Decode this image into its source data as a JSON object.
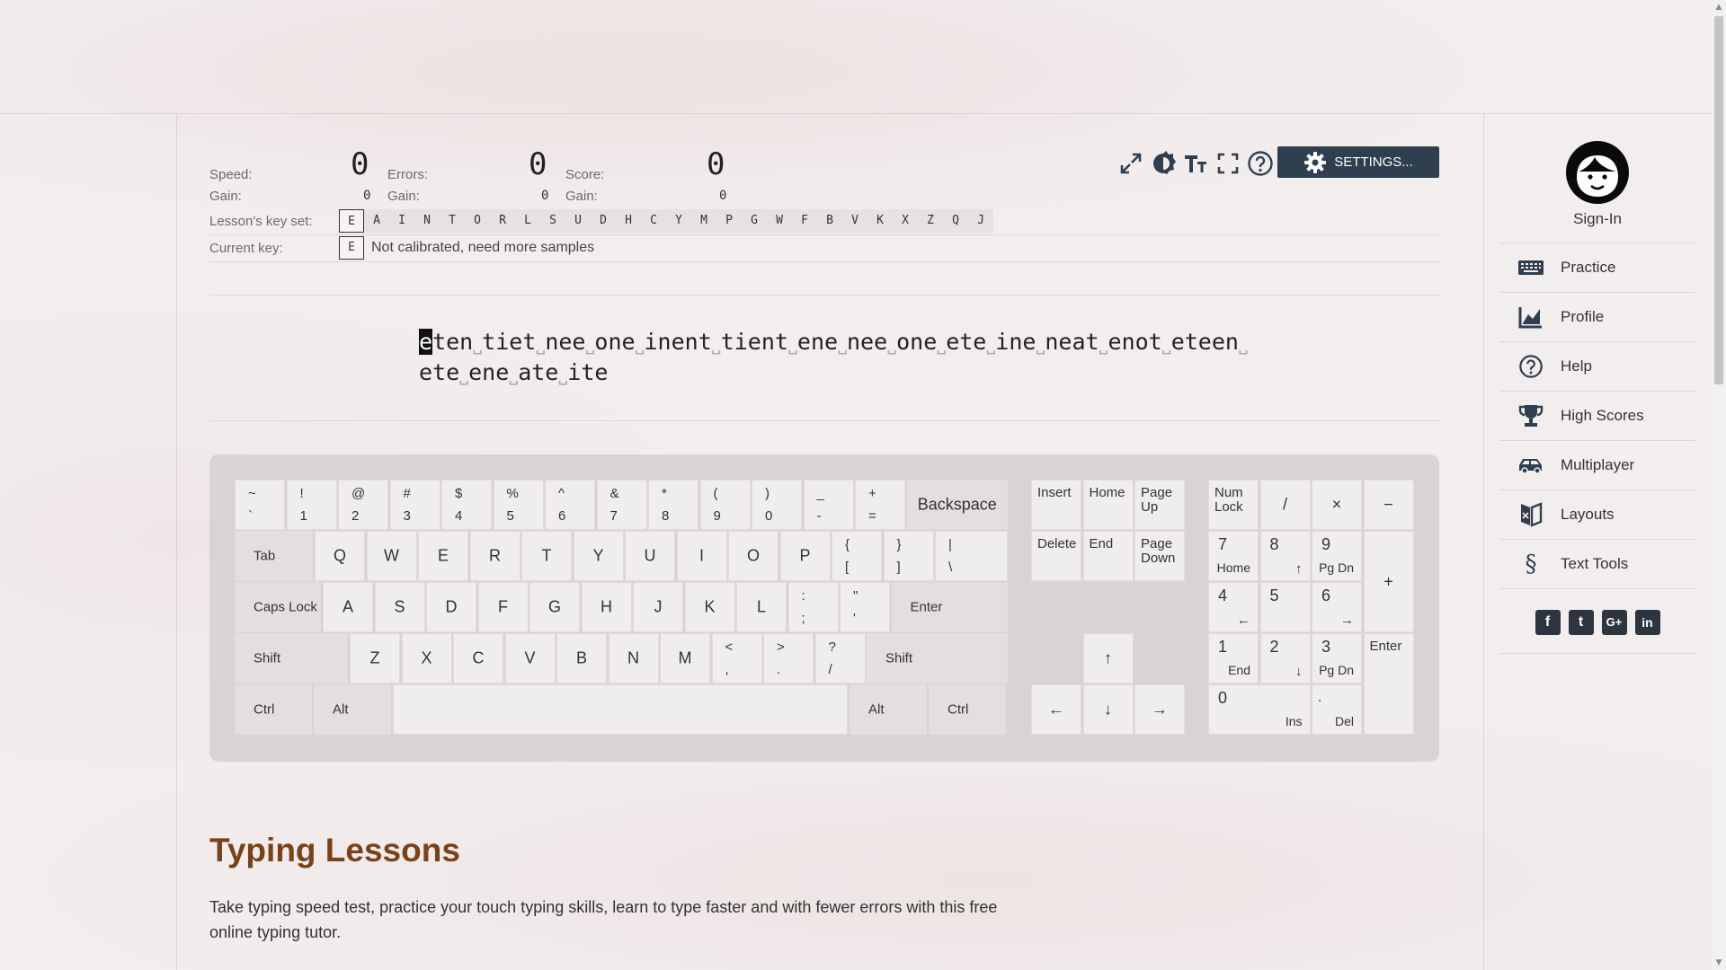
{
  "stats": {
    "speed_label": "Speed:",
    "speed_value": "0",
    "errors_label": "Errors:",
    "errors_value": "0",
    "score_label": "Score:",
    "score_value": "0",
    "gain_label": "Gain:",
    "speed_gain": "0",
    "errors_gain": "0",
    "score_gain": "0",
    "keyset_label": "Lesson's key set:",
    "keyset": [
      "E",
      "A",
      "I",
      "N",
      "T",
      "O",
      "R",
      "L",
      "S",
      "U",
      "D",
      "H",
      "C",
      "Y",
      "M",
      "P",
      "G",
      "W",
      "F",
      "B",
      "V",
      "K",
      "X",
      "Z",
      "Q",
      "J"
    ],
    "current_key_label": "Current key:",
    "current_key": "E",
    "current_status": "Not calibrated, need more samples"
  },
  "toolbar": {
    "settings_label": "SETTINGS...",
    "icons": [
      "expand-icon",
      "theme-icon",
      "font-size-icon",
      "fullscreen-icon",
      "help-icon",
      "gear-icon"
    ]
  },
  "lesson": {
    "cursor_char": "e",
    "line1_words": [
      "ten",
      "tiet",
      "nee",
      "one",
      "inent",
      "tient",
      "ene",
      "nee",
      "one",
      "ete",
      "ine",
      "neat",
      "enot",
      "eteen"
    ],
    "line2_words": [
      "ete",
      "ene",
      "ate",
      "ite"
    ]
  },
  "keyboard": {
    "row1": [
      [
        "~",
        "`"
      ],
      [
        "!",
        "1"
      ],
      [
        "@",
        "2"
      ],
      [
        "#",
        "3"
      ],
      [
        "$",
        "4"
      ],
      [
        "%",
        "5"
      ],
      [
        "^",
        "6"
      ],
      [
        "&",
        "7"
      ],
      [
        "*",
        "8"
      ],
      [
        "(",
        "9"
      ],
      [
        ")",
        "0"
      ],
      [
        "_",
        "-"
      ],
      [
        "+",
        "="
      ]
    ],
    "backspace": "Backspace",
    "tab": "Tab",
    "row2": [
      "Q",
      "W",
      "E",
      "R",
      "T",
      "Y",
      "U",
      "I",
      "O",
      "P"
    ],
    "row2_sym": [
      [
        "{",
        "["
      ],
      [
        "}",
        "]"
      ],
      [
        "|",
        "\\"
      ]
    ],
    "caps": "Caps Lock",
    "row3": [
      "A",
      "S",
      "D",
      "F",
      "G",
      "H",
      "J",
      "K",
      "L"
    ],
    "row3_sym": [
      [
        ":",
        ";"
      ],
      [
        "\"",
        "'"
      ]
    ],
    "enter": "Enter",
    "shift": "Shift",
    "row4": [
      "Z",
      "X",
      "C",
      "V",
      "B",
      "N",
      "M"
    ],
    "row4_sym": [
      [
        "<",
        ","
      ],
      [
        ">",
        "."
      ],
      [
        "?",
        "/"
      ]
    ],
    "ctrl": "Ctrl",
    "alt": "Alt",
    "nav": {
      "insert": "Insert",
      "home": "Home",
      "pageup": "Page Up",
      "delete": "Delete",
      "end": "End",
      "pagedown": "Page Down"
    },
    "arrows": {
      "up": "↑",
      "left": "←",
      "down": "↓",
      "right": "→"
    },
    "numpad": {
      "numlock": "Num Lock",
      "divide": "/",
      "multiply": "×",
      "minus": "−",
      "plus": "+",
      "enter": "Enter",
      "n7": "7",
      "n7b": "Home",
      "n8": "8",
      "n8b": "↑",
      "n9": "9",
      "n9b": "Pg Dn",
      "n4": "4",
      "n4b": "←",
      "n5": "5",
      "n6": "6",
      "n6b": "→",
      "n1": "1",
      "n1b": "End",
      "n2": "2",
      "n2b": "↓",
      "n3": "3",
      "n3b": "Pg Dn",
      "n0": "0",
      "n0b": "Ins",
      "dot": ".",
      "dotb": "Del"
    }
  },
  "content": {
    "heading": "Typing Lessons",
    "paragraph": "Take typing speed test, practice your touch typing skills, learn to type faster and with fewer errors with this free online typing tutor."
  },
  "sidebar": {
    "signin": "Sign-In",
    "items": [
      {
        "label": "Practice",
        "icon": "keyboard-icon"
      },
      {
        "label": "Profile",
        "icon": "chart-icon"
      },
      {
        "label": "Help",
        "icon": "help-icon"
      },
      {
        "label": "High Scores",
        "icon": "trophy-icon"
      },
      {
        "label": "Multiplayer",
        "icon": "car-icon"
      },
      {
        "label": "Layouts",
        "icon": "layouts-icon"
      },
      {
        "label": "Text Tools",
        "icon": "section-icon"
      }
    ],
    "social": [
      {
        "label": "f",
        "icon": "facebook-icon"
      },
      {
        "label": "t",
        "icon": "twitter-icon"
      },
      {
        "label": "G+",
        "icon": "google-plus-icon"
      },
      {
        "label": "in",
        "icon": "linkedin-icon"
      }
    ]
  },
  "colors": {
    "settings_bg": "#2f3f4f",
    "heading": "#7a4218",
    "page_bg": "#f3eeee"
  }
}
